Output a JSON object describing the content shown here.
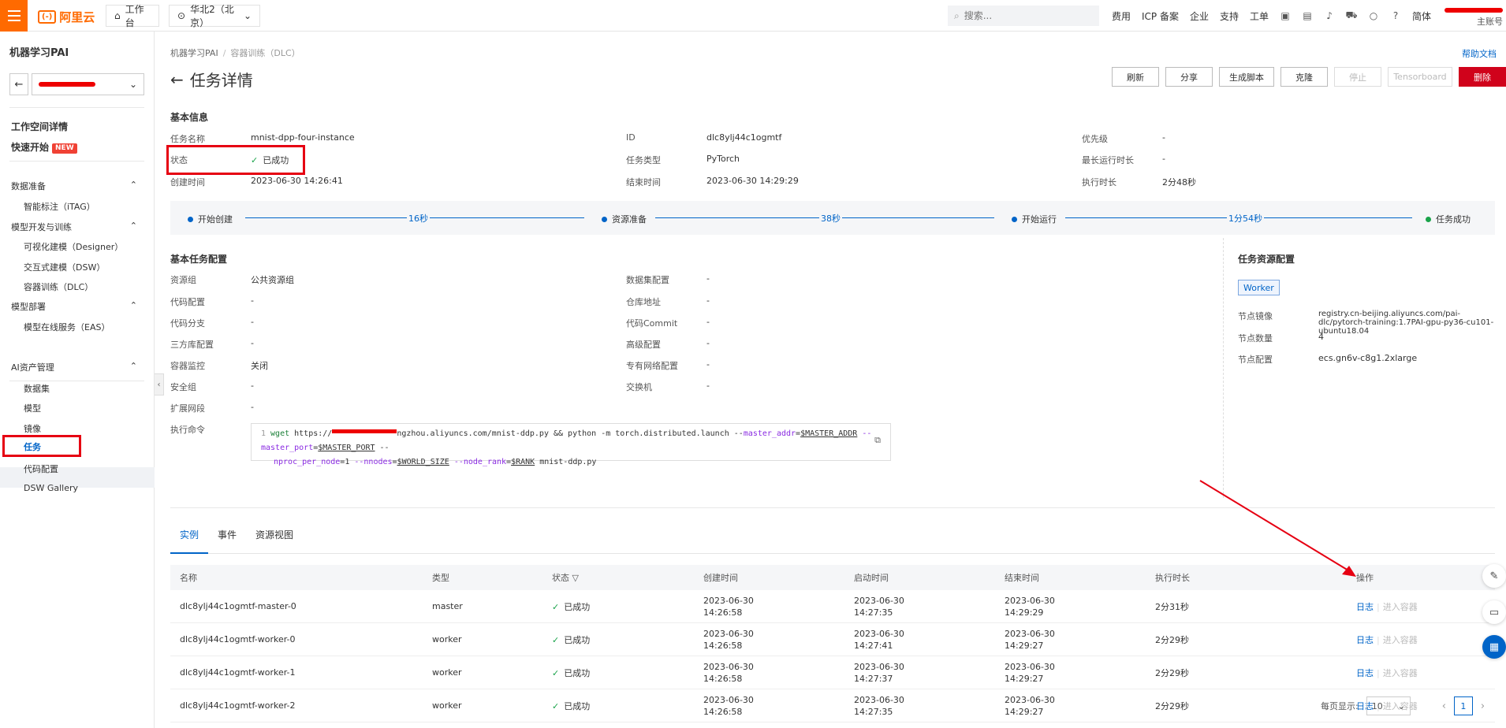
{
  "topbar": {
    "brand": "阿里云",
    "workbench": "工作台",
    "region": "华北2（北京）",
    "search_placeholder": "搜索...",
    "links": [
      "费用",
      "ICP 备案",
      "企业",
      "支持",
      "工单"
    ],
    "lang": "简体",
    "user_sub": "主账号"
  },
  "sidebar": {
    "title": "机器学习PAI",
    "ws_detail": "工作空间详情",
    "quick_start": "快速开始",
    "new_badge": "NEW",
    "groups": [
      {
        "label": "数据准备",
        "items": [
          "智能标注（iTAG）"
        ]
      },
      {
        "label": "模型开发与训练",
        "items": [
          "可视化建模（Designer）",
          "交互式建模（DSW）",
          "容器训练（DLC）"
        ]
      },
      {
        "label": "模型部署",
        "items": [
          "模型在线服务（EAS）"
        ]
      },
      {
        "label": "AI资产管理",
        "items": [
          "数据集",
          "模型",
          "镜像",
          "任务",
          "代码配置",
          "DSW Gallery"
        ]
      }
    ]
  },
  "breadcrumb": [
    "机器学习PAI",
    "容器训练（DLC）"
  ],
  "help_doc": "帮助文档",
  "page_title": "任务详情",
  "actions": [
    "刷新",
    "分享",
    "生成脚本",
    "克隆",
    "停止",
    "Tensorboard",
    "删除"
  ],
  "basic": {
    "title": "基本信息",
    "rows": [
      [
        "任务名称",
        "mnist-dpp-four-instance",
        "ID",
        "dlc8ylj44c1ogmtf",
        "优先级",
        "-"
      ],
      [
        "状态",
        "已成功",
        "任务类型",
        "PyTorch",
        "最长运行时长",
        "-"
      ],
      [
        "创建时间",
        "2023-06-30 14:26:41",
        "结束时间",
        "2023-06-30 14:29:29",
        "执行时长",
        "2分48秒"
      ]
    ]
  },
  "timeline": {
    "nodes": [
      "开始创建",
      "资源准备",
      "开始运行",
      "任务成功"
    ],
    "durations": [
      "16秒",
      "38秒",
      "1分54秒"
    ]
  },
  "config": {
    "title": "基本任务配置",
    "left": [
      [
        "资源组",
        "公共资源组"
      ],
      [
        "代码配置",
        "-"
      ],
      [
        "代码分支",
        "-"
      ],
      [
        "三方库配置",
        "-"
      ],
      [
        "容器监控",
        "关闭"
      ],
      [
        "安全组",
        "-"
      ],
      [
        "扩展网段",
        "-"
      ],
      [
        "执行命令",
        ""
      ]
    ],
    "mid": [
      [
        "数据集配置",
        "-"
      ],
      [
        "仓库地址",
        "-"
      ],
      [
        "代码Commit",
        "-"
      ],
      [
        "高级配置",
        "-"
      ],
      [
        "专有网络配置",
        "-"
      ],
      [
        "交换机",
        "-"
      ]
    ]
  },
  "command": {
    "line_no": "1",
    "p1": "wget",
    "p2": " https://",
    "p3": "ngzhou.aliyuncs.com/mnist-ddp.py &&   python -m torch.distributed.launch --",
    "a1": "master_addr",
    "e1": "=",
    "v1": "$MASTER_ADDR",
    "a2": " --master_port",
    "v2": "$MASTER_PORT",
    "tail": " --",
    "a3": "nproc_per_node",
    "n1": "=1",
    "a4": " --nnodes",
    "v3": "$WORLD_SIZE",
    "a5": " --node_rank",
    "v4": "$RANK",
    "end": " mnist-ddp.py"
  },
  "resource": {
    "title": "任务资源配置",
    "tag": "Worker",
    "rows": [
      [
        "节点镜像",
        "registry.cn-beijing.aliyuncs.com/pai-dlc/pytorch-training:1.7PAI-gpu-py36-cu101-ubuntu18.04"
      ],
      [
        "节点数量",
        "4"
      ],
      [
        "节点配置",
        "ecs.gn6v-c8g1.2xlarge"
      ]
    ]
  },
  "tabs": [
    "实例",
    "事件",
    "资源视图"
  ],
  "table": {
    "headers": [
      "名称",
      "类型",
      "状态",
      "创建时间",
      "启动时间",
      "结束时间",
      "执行时长",
      "操作"
    ],
    "rows": [
      {
        "name": "dlc8ylj44c1ogmtf-master-0",
        "type": "master",
        "status": "已成功",
        "c1": "2023-06-30",
        "c2": "14:26:58",
        "s1": "2023-06-30",
        "s2": "14:27:35",
        "e1": "2023-06-30",
        "e2": "14:29:29",
        "dur": "2分31秒"
      },
      {
        "name": "dlc8ylj44c1ogmtf-worker-0",
        "type": "worker",
        "status": "已成功",
        "c1": "2023-06-30",
        "c2": "14:26:58",
        "s1": "2023-06-30",
        "s2": "14:27:41",
        "e1": "2023-06-30",
        "e2": "14:29:27",
        "dur": "2分29秒"
      },
      {
        "name": "dlc8ylj44c1ogmtf-worker-1",
        "type": "worker",
        "status": "已成功",
        "c1": "2023-06-30",
        "c2": "14:26:58",
        "s1": "2023-06-30",
        "s2": "14:27:37",
        "e1": "2023-06-30",
        "e2": "14:29:27",
        "dur": "2分29秒"
      },
      {
        "name": "dlc8ylj44c1ogmtf-worker-2",
        "type": "worker",
        "status": "已成功",
        "c1": "2023-06-30",
        "c2": "14:26:58",
        "s1": "2023-06-30",
        "s2": "14:27:35",
        "e1": "2023-06-30",
        "e2": "14:29:27",
        "dur": "2分29秒"
      }
    ],
    "op_log": "日志",
    "op_enter": "进入容器"
  },
  "pager": {
    "label": "每页显示:",
    "size": "10",
    "page": "1"
  },
  "colors": {
    "brand": "#ff6a00",
    "primary": "#0064c8",
    "danger": "#d0021b",
    "success": "#1aa34a",
    "highlight": "#e60012"
  }
}
